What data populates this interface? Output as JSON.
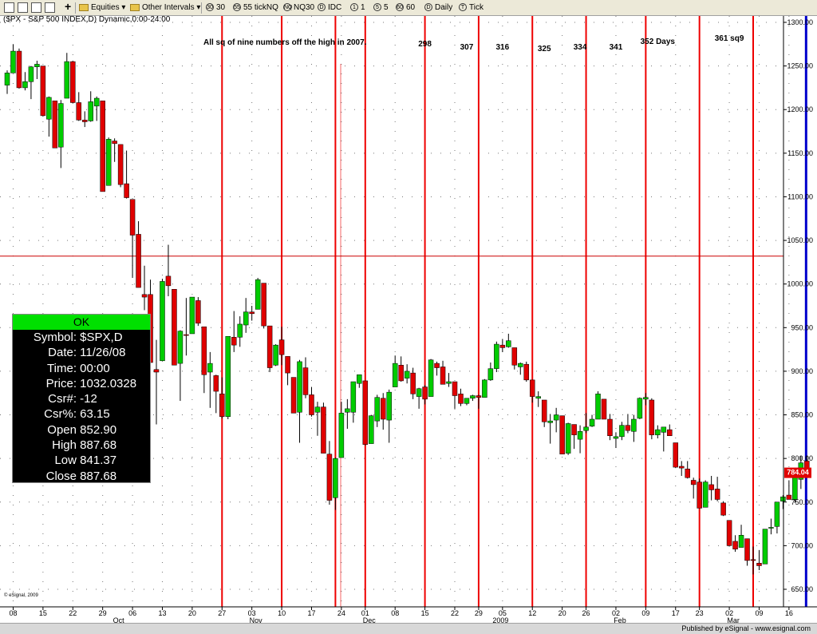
{
  "toolbar": {
    "interval_menu": "Equities",
    "other_menu": "Other Intervals",
    "buttons": [
      {
        "badge": "30",
        "label": "30"
      },
      {
        "badge": "55",
        "label": "55 tickNQ"
      },
      {
        "badge": "NQ",
        "label": "NQ30"
      },
      {
        "badge": "D",
        "label": "IDC"
      },
      {
        "badge": "1",
        "label": "1"
      },
      {
        "badge": "5",
        "label": "5"
      },
      {
        "badge": "60",
        "label": "60"
      },
      {
        "badge": "D",
        "label": "Daily"
      },
      {
        "badge": "T",
        "label": "Tick"
      }
    ]
  },
  "chart_title": "($PX - S&P 500 INDEX,D) Dynamic,0:00-24:00",
  "annotation_main": "All sq of nine numbers off the high in 2007.",
  "day_labels": [
    {
      "text": "298",
      "day": "2008-12-15"
    },
    {
      "text": "307",
      "day": "2008-12-24"
    },
    {
      "text": "316",
      "day": "2009-01-05"
    },
    {
      "text": "325",
      "day": "2009-01-14"
    },
    {
      "text": "334",
      "day": "2009-01-23"
    },
    {
      "text": "341",
      "day": "2009-02-02"
    },
    {
      "text": "352 Days",
      "day": "2009-02-11"
    },
    {
      "text": "361 sq9",
      "day": "2009-03-02"
    }
  ],
  "price_label": "784.04",
  "watermark": "© eSignal, 2009",
  "footer": "Published by eSignal - www.esignal.com",
  "info_panel": {
    "ok": "OK",
    "rows": [
      {
        "label": "Symbol:",
        "value": "$SPX,D"
      },
      {
        "label": "Date:",
        "value": "11/26/08"
      },
      {
        "label": "Time:",
        "value": "00:00"
      },
      {
        "label": "Price:",
        "value": "1032.0328"
      },
      {
        "label": "Csr#:",
        "value": "-12"
      },
      {
        "label": "Csr%:",
        "value": "63.15"
      },
      {
        "label": "Open",
        "value": "852.90"
      },
      {
        "label": "High",
        "value": "887.68"
      },
      {
        "label": "Low",
        "value": "841.37"
      },
      {
        "label": "Close",
        "value": "887.68"
      }
    ]
  },
  "colors": {
    "up": "#00cc00",
    "down": "#e00000",
    "cycle_line": "#ee0000",
    "current_line": "#0000cc",
    "crosshair": "#cc0000"
  },
  "chart_data": {
    "type": "candlestick",
    "title": "($PX - S&P 500 INDEX,D) Dynamic,0:00-24:00",
    "ylim": [
      630,
      1310
    ],
    "y_ticks": [
      650,
      700,
      750,
      800,
      850,
      900,
      950,
      1000,
      1050,
      1100,
      1150,
      1200,
      1250,
      1300
    ],
    "y_tick_labels": [
      "650.00",
      "700.00",
      "750.00",
      "800.00",
      "850.00",
      "900.00",
      "950.00",
      "1000.00",
      "1050.00",
      "1100.00",
      "1150.00",
      "1200.00",
      "1250.00",
      "1300.00"
    ],
    "crosshair_price": 1032.03,
    "last_price": 784.04,
    "x_ticks": [
      {
        "label": "08",
        "day": "2008-09-08"
      },
      {
        "label": "15",
        "day": "2008-09-15"
      },
      {
        "label": "22",
        "day": "2008-09-22"
      },
      {
        "label": "29",
        "day": "2008-09-29"
      },
      {
        "label": "06",
        "day": "2008-10-06"
      },
      {
        "label": "13",
        "day": "2008-10-13"
      },
      {
        "label": "20",
        "day": "2008-10-20"
      },
      {
        "label": "27",
        "day": "2008-10-27"
      },
      {
        "label": "03",
        "day": "2008-11-03"
      },
      {
        "label": "10",
        "day": "2008-11-10"
      },
      {
        "label": "17",
        "day": "2008-11-17"
      },
      {
        "label": "24",
        "day": "2008-11-24"
      },
      {
        "label": "01",
        "day": "2008-12-01"
      },
      {
        "label": "08",
        "day": "2008-12-08"
      },
      {
        "label": "15",
        "day": "2008-12-15"
      },
      {
        "label": "22",
        "day": "2008-12-22"
      },
      {
        "label": "29",
        "day": "2008-12-29"
      },
      {
        "label": "05",
        "day": "2009-01-05"
      },
      {
        "label": "12",
        "day": "2009-01-12"
      },
      {
        "label": "20",
        "day": "2009-01-20"
      },
      {
        "label": "26",
        "day": "2009-01-26"
      },
      {
        "label": "02",
        "day": "2009-02-02"
      },
      {
        "label": "09",
        "day": "2009-02-09"
      },
      {
        "label": "17",
        "day": "2009-02-17"
      },
      {
        "label": "23",
        "day": "2009-02-23"
      },
      {
        "label": "02",
        "day": "2009-03-02"
      },
      {
        "label": "09",
        "day": "2009-03-09"
      },
      {
        "label": "16",
        "day": "2009-03-16"
      }
    ],
    "x_period_labels": [
      {
        "label": "Oct",
        "day": "2008-10-01"
      },
      {
        "label": "Nov",
        "day": "2008-11-03"
      },
      {
        "label": "Dec",
        "day": "2008-12-01"
      },
      {
        "label": "2009",
        "day": "2009-01-02"
      },
      {
        "label": "Feb",
        "day": "2009-02-02"
      },
      {
        "label": "Mar",
        "day": "2009-03-02"
      }
    ],
    "cycle_lines": [
      "2008-10-27",
      "2008-11-10",
      "2008-11-21",
      "2008-12-01",
      "2008-12-15",
      "2008-12-29",
      "2009-01-12",
      "2009-01-26",
      "2009-02-09",
      "2009-02-23",
      "2009-03-06"
    ],
    "current_line": "2009-03-19",
    "candles": [
      [
        "2008-09-05",
        1228,
        1245,
        1218,
        1242
      ],
      [
        "2008-09-08",
        1242,
        1275,
        1242,
        1267
      ],
      [
        "2008-09-09",
        1267,
        1270,
        1224,
        1225
      ],
      [
        "2008-09-10",
        1225,
        1243,
        1222,
        1232
      ],
      [
        "2008-09-11",
        1232,
        1250,
        1212,
        1249
      ],
      [
        "2008-09-12",
        1249,
        1256,
        1235,
        1252
      ],
      [
        "2008-09-15",
        1250,
        1250,
        1192,
        1193
      ],
      [
        "2008-09-16",
        1189,
        1215,
        1169,
        1214
      ],
      [
        "2008-09-17",
        1210,
        1210,
        1156,
        1156
      ],
      [
        "2008-09-18",
        1157,
        1211,
        1133,
        1207
      ],
      [
        "2008-09-19",
        1213,
        1265,
        1213,
        1255
      ],
      [
        "2008-09-22",
        1255,
        1256,
        1207,
        1208
      ],
      [
        "2008-09-23",
        1208,
        1220,
        1187,
        1188
      ],
      [
        "2008-09-24",
        1188,
        1198,
        1180,
        1186
      ],
      [
        "2008-09-25",
        1187,
        1221,
        1186,
        1209
      ],
      [
        "2008-09-26",
        1204,
        1215,
        1187,
        1213
      ],
      [
        "2008-09-29",
        1210,
        1210,
        1106,
        1106
      ],
      [
        "2008-09-30",
        1113,
        1168,
        1113,
        1166
      ],
      [
        "2008-10-01",
        1164,
        1167,
        1140,
        1161
      ],
      [
        "2008-10-02",
        1160,
        1160,
        1111,
        1114
      ],
      [
        "2008-10-03",
        1115,
        1153,
        1098,
        1099
      ],
      [
        "2008-10-06",
        1097,
        1097,
        1007,
        1056
      ],
      [
        "2008-10-07",
        1057,
        1072,
        996,
        996
      ],
      [
        "2008-10-08",
        988,
        1021,
        970,
        985
      ],
      [
        "2008-10-09",
        988,
        1005,
        909,
        910
      ],
      [
        "2008-10-10",
        902,
        936,
        839,
        899
      ],
      [
        "2008-10-13",
        912,
        1006,
        912,
        1003
      ],
      [
        "2008-10-14",
        1009,
        1045,
        986,
        998
      ],
      [
        "2008-10-15",
        994,
        994,
        907,
        907
      ],
      [
        "2008-10-16",
        909,
        947,
        866,
        946
      ],
      [
        "2008-10-17",
        942,
        984,
        918,
        941
      ],
      [
        "2008-10-20",
        943,
        985,
        943,
        985
      ],
      [
        "2008-10-21",
        981,
        985,
        952,
        955
      ],
      [
        "2008-10-22",
        951,
        951,
        875,
        896
      ],
      [
        "2008-10-23",
        899,
        922,
        858,
        909
      ],
      [
        "2008-10-24",
        895,
        896,
        852,
        877
      ],
      [
        "2008-10-27",
        874,
        893,
        846,
        848
      ],
      [
        "2008-10-28",
        848,
        940,
        845,
        940
      ],
      [
        "2008-10-29",
        939,
        969,
        922,
        930
      ],
      [
        "2008-10-30",
        939,
        963,
        928,
        954
      ],
      [
        "2008-10-31",
        953,
        984,
        944,
        968
      ],
      [
        "2008-11-03",
        968,
        975,
        958,
        966
      ],
      [
        "2008-11-04",
        971,
        1007,
        971,
        1005
      ],
      [
        "2008-11-05",
        1001,
        1001,
        949,
        952
      ],
      [
        "2008-11-06",
        952,
        952,
        899,
        904
      ],
      [
        "2008-11-07",
        907,
        931,
        906,
        930
      ],
      [
        "2008-11-10",
        936,
        951,
        907,
        919
      ],
      [
        "2008-11-11",
        917,
        917,
        884,
        898
      ],
      [
        "2008-11-12",
        893,
        893,
        852,
        852
      ],
      [
        "2008-11-13",
        853,
        913,
        818,
        911
      ],
      [
        "2008-11-14",
        904,
        916,
        869,
        873
      ],
      [
        "2008-11-17",
        873,
        882,
        848,
        850
      ],
      [
        "2008-11-18",
        853,
        865,
        826,
        859
      ],
      [
        "2008-11-19",
        859,
        864,
        806,
        806
      ],
      [
        "2008-11-20",
        805,
        820,
        747,
        752
      ],
      [
        "2008-11-21",
        755,
        801,
        741,
        800
      ],
      [
        "2008-11-24",
        801,
        865,
        801,
        852
      ],
      [
        "2008-11-25",
        853,
        868,
        834,
        857
      ],
      [
        "2008-11-26",
        853,
        888,
        841,
        888
      ],
      [
        "2008-11-28",
        886,
        896,
        881,
        896
      ],
      [
        "2008-12-01",
        889,
        889,
        815,
        816
      ],
      [
        "2008-12-02",
        817,
        850,
        817,
        849
      ],
      [
        "2008-12-03",
        843,
        873,
        836,
        870
      ],
      [
        "2008-12-04",
        869,
        875,
        833,
        845
      ],
      [
        "2008-12-05",
        844,
        879,
        818,
        876
      ],
      [
        "2008-12-08",
        882,
        918,
        882,
        909
      ],
      [
        "2008-12-09",
        907,
        917,
        888,
        889
      ],
      [
        "2008-12-10",
        892,
        908,
        886,
        900
      ],
      [
        "2008-12-11",
        898,
        904,
        868,
        874
      ],
      [
        "2008-12-12",
        871,
        881,
        857,
        880
      ],
      [
        "2008-12-15",
        882,
        884,
        862,
        868
      ],
      [
        "2008-12-16",
        871,
        914,
        871,
        913
      ],
      [
        "2008-12-17",
        909,
        911,
        895,
        904
      ],
      [
        "2008-12-18",
        905,
        912,
        885,
        885
      ],
      [
        "2008-12-19",
        886,
        898,
        882,
        888
      ],
      [
        "2008-12-22",
        888,
        888,
        857,
        872
      ],
      [
        "2008-12-23",
        874,
        880,
        860,
        863
      ],
      [
        "2008-12-24",
        863,
        869,
        861,
        869
      ],
      [
        "2008-12-26",
        869,
        873,
        866,
        872
      ],
      [
        "2008-12-29",
        872,
        873,
        857,
        870
      ],
      [
        "2008-12-30",
        870,
        891,
        870,
        890
      ],
      [
        "2008-12-31",
        890,
        910,
        889,
        903
      ],
      [
        "2009-01-02",
        903,
        934,
        899,
        931
      ],
      [
        "2009-01-05",
        930,
        937,
        922,
        927
      ],
      [
        "2009-01-06",
        928,
        943,
        927,
        935
      ],
      [
        "2009-01-07",
        927,
        927,
        902,
        907
      ],
      [
        "2009-01-08",
        905,
        910,
        896,
        909
      ],
      [
        "2009-01-09",
        908,
        911,
        888,
        890
      ],
      [
        "2009-01-12",
        890,
        890,
        864,
        871
      ],
      [
        "2009-01-13",
        869,
        877,
        859,
        871
      ],
      [
        "2009-01-14",
        867,
        867,
        836,
        842
      ],
      [
        "2009-01-15",
        841,
        851,
        817,
        843
      ],
      [
        "2009-01-16",
        844,
        858,
        830,
        850
      ],
      [
        "2009-01-20",
        849,
        849,
        805,
        805
      ],
      [
        "2009-01-21",
        806,
        841,
        804,
        840
      ],
      [
        "2009-01-22",
        839,
        839,
        811,
        827
      ],
      [
        "2009-01-23",
        822,
        838,
        806,
        831
      ],
      [
        "2009-01-26",
        832,
        852,
        829,
        836
      ],
      [
        "2009-01-27",
        837,
        850,
        836,
        845
      ],
      [
        "2009-01-28",
        845,
        877,
        845,
        874
      ],
      [
        "2009-01-29",
        868,
        868,
        845,
        845
      ],
      [
        "2009-01-30",
        845,
        851,
        821,
        826
      ],
      [
        "2009-02-02",
        823,
        830,
        812,
        825
      ],
      [
        "2009-02-03",
        825,
        842,
        821,
        838
      ],
      [
        "2009-02-04",
        838,
        851,
        829,
        832
      ],
      [
        "2009-02-05",
        831,
        850,
        819,
        845
      ],
      [
        "2009-02-06",
        846,
        870,
        845,
        869
      ],
      [
        "2009-02-09",
        868,
        875,
        861,
        870
      ],
      [
        "2009-02-10",
        867,
        869,
        822,
        827
      ],
      [
        "2009-02-11",
        827,
        838,
        823,
        833
      ],
      [
        "2009-02-12",
        830,
        835,
        808,
        836
      ],
      [
        "2009-02-13",
        833,
        839,
        826,
        826
      ],
      [
        "2009-02-17",
        818,
        818,
        789,
        790
      ],
      [
        "2009-02-18",
        791,
        797,
        780,
        789
      ],
      [
        "2009-02-19",
        788,
        797,
        777,
        778
      ],
      [
        "2009-02-20",
        775,
        778,
        754,
        770
      ],
      [
        "2009-02-23",
        773,
        777,
        743,
        743
      ],
      [
        "2009-02-24",
        744,
        775,
        744,
        773
      ],
      [
        "2009-02-25",
        770,
        780,
        752,
        764
      ],
      [
        "2009-02-26",
        765,
        779,
        751,
        753
      ],
      [
        "2009-02-27",
        749,
        751,
        734,
        735
      ],
      [
        "2009-03-02",
        729,
        729,
        699,
        700
      ],
      [
        "2009-03-03",
        705,
        712,
        693,
        696
      ],
      [
        "2009-03-04",
        698,
        724,
        698,
        712
      ],
      [
        "2009-03-05",
        708,
        708,
        677,
        683
      ],
      [
        "2009-03-06",
        684,
        699,
        667,
        683
      ],
      [
        "2009-03-09",
        680,
        695,
        672,
        677
      ],
      [
        "2009-03-10",
        679,
        719,
        679,
        719
      ],
      [
        "2009-03-11",
        720,
        731,
        713,
        721
      ],
      [
        "2009-03-12",
        722,
        750,
        714,
        750
      ],
      [
        "2009-03-13",
        751,
        758,
        742,
        756
      ],
      [
        "2009-03-16",
        758,
        775,
        753,
        753
      ],
      [
        "2009-03-17",
        753,
        778,
        749,
        778
      ],
      [
        "2009-03-18",
        776,
        803,
        765,
        795
      ],
      [
        "2009-03-19",
        797,
        803,
        779,
        784
      ]
    ]
  }
}
